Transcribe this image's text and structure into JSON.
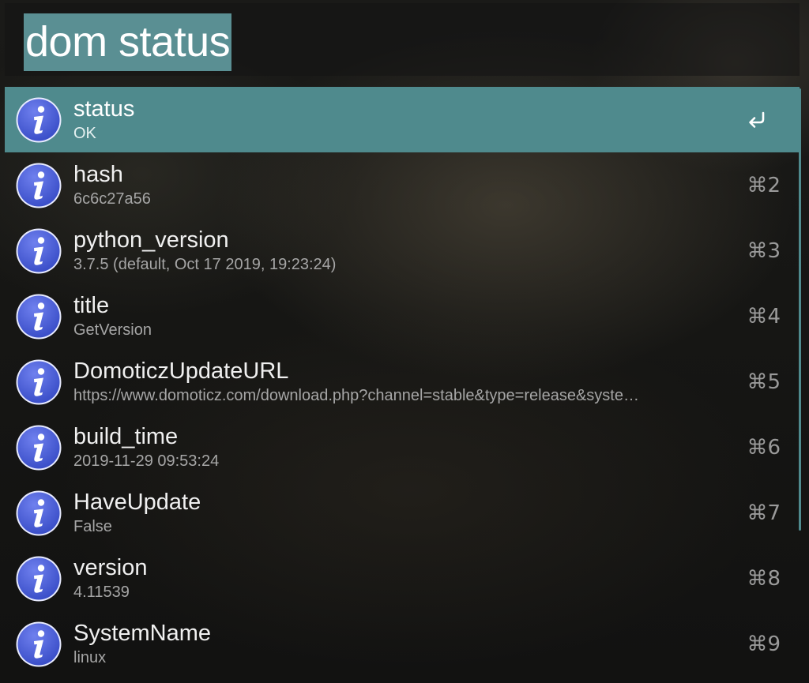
{
  "search": {
    "query": "dom status"
  },
  "results": [
    {
      "title": "status",
      "subtitle": "OK",
      "shortcut": "",
      "selected": true
    },
    {
      "title": "hash",
      "subtitle": "6c6c27a56",
      "shortcut": "⌘2"
    },
    {
      "title": "python_version",
      "subtitle": "3.7.5 (default, Oct 17 2019, 19:23:24)",
      "shortcut": "⌘3"
    },
    {
      "title": "title",
      "subtitle": "GetVersion",
      "shortcut": "⌘4"
    },
    {
      "title": "DomoticzUpdateURL",
      "subtitle": "https://www.domoticz.com/download.php?channel=stable&type=release&syste…",
      "shortcut": "⌘5"
    },
    {
      "title": "build_time",
      "subtitle": "2019-11-29 09:53:24",
      "shortcut": "⌘6"
    },
    {
      "title": "HaveUpdate",
      "subtitle": "False",
      "shortcut": "⌘7"
    },
    {
      "title": "version",
      "subtitle": "4.11539",
      "shortcut": "⌘8"
    },
    {
      "title": "SystemName",
      "subtitle": "linux",
      "shortcut": "⌘9"
    }
  ],
  "icons": {
    "result_icon": "info-icon",
    "selected_action": "return-key-icon"
  },
  "colors": {
    "selection": "#4f8a8d",
    "query_highlight": "#5a8f93",
    "icon_fill": "#3b4fc9"
  }
}
